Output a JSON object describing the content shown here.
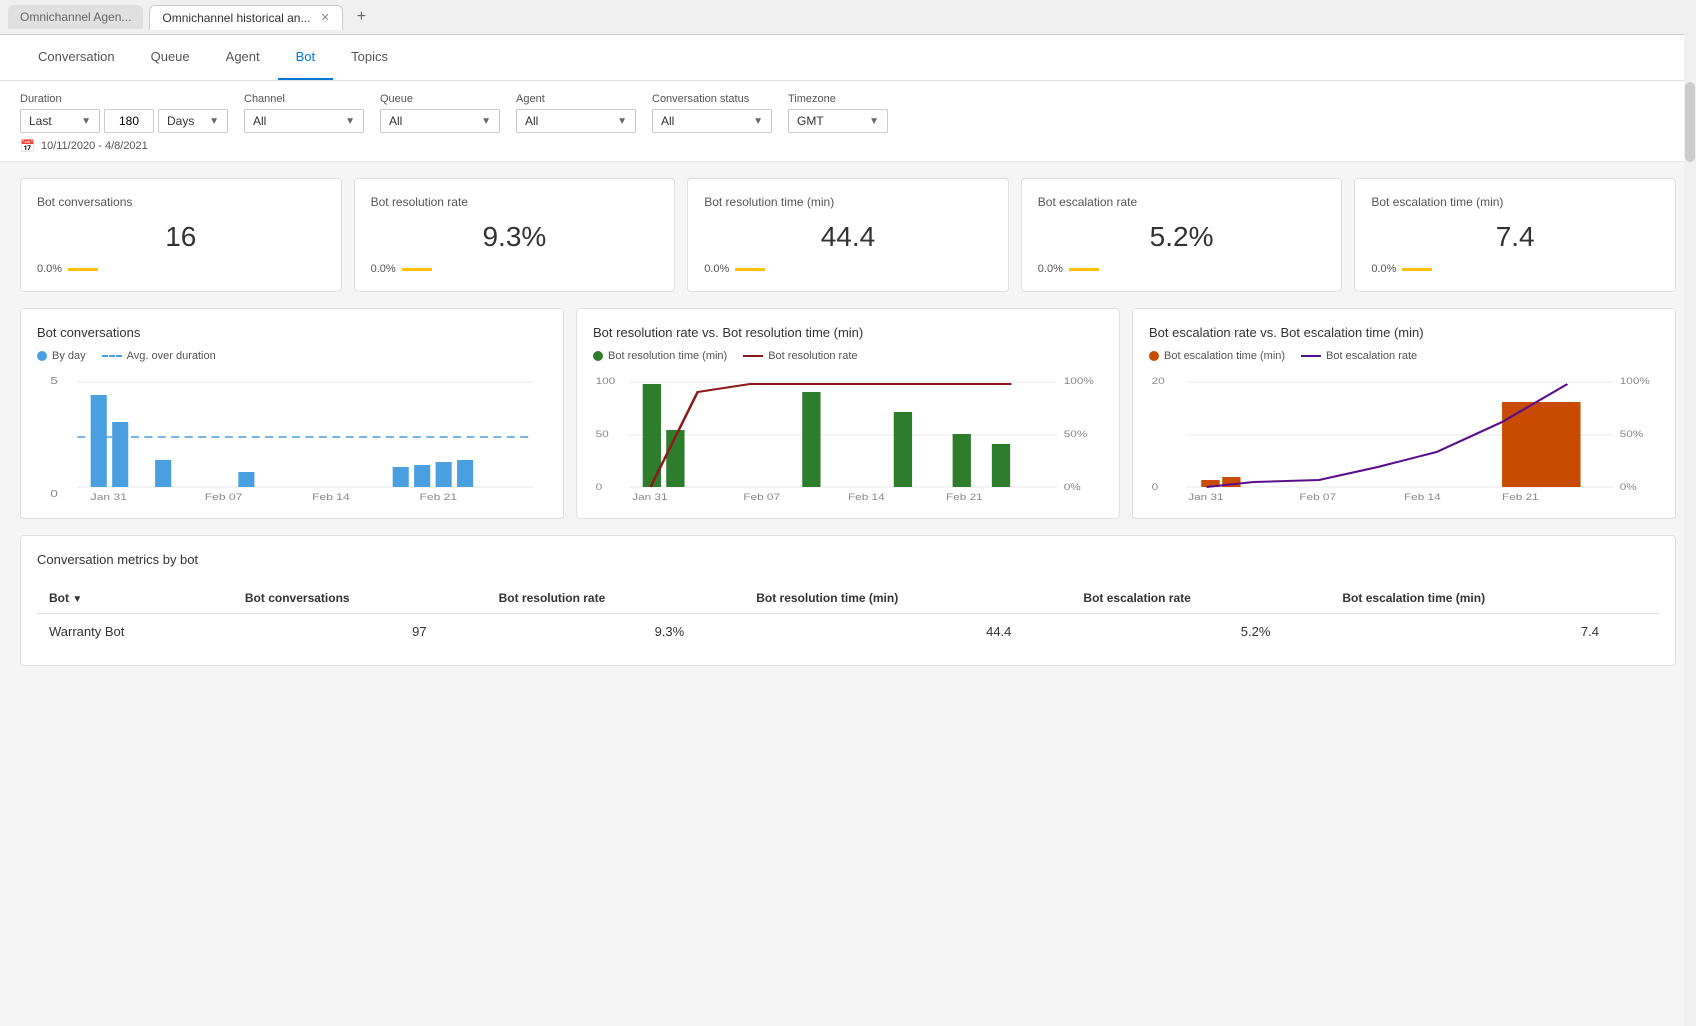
{
  "browser": {
    "tabs": [
      {
        "id": "tab1",
        "label": "Omnichannel Agen...",
        "active": false
      },
      {
        "id": "tab2",
        "label": "Omnichannel historical an...",
        "active": true
      }
    ],
    "add_tab_label": "+"
  },
  "nav": {
    "tabs": [
      {
        "id": "conversation",
        "label": "Conversation",
        "active": false
      },
      {
        "id": "queue",
        "label": "Queue",
        "active": false
      },
      {
        "id": "agent",
        "label": "Agent",
        "active": false
      },
      {
        "id": "bot",
        "label": "Bot",
        "active": true
      },
      {
        "id": "topics",
        "label": "Topics",
        "active": false
      }
    ]
  },
  "filters": {
    "duration_label": "Duration",
    "duration_preset": "Last",
    "duration_value": "180",
    "duration_unit": "Days",
    "channel_label": "Channel",
    "channel_value": "All",
    "queue_label": "Queue",
    "queue_value": "All",
    "agent_label": "Agent",
    "agent_value": "All",
    "conversation_status_label": "Conversation status",
    "conversation_status_value": "All",
    "timezone_label": "Timezone",
    "timezone_value": "GMT",
    "date_range": "10/11/2020 - 4/8/2021"
  },
  "kpis": [
    {
      "title": "Bot conversations",
      "value": "16",
      "change": "0.0%"
    },
    {
      "title": "Bot resolution rate",
      "value": "9.3%",
      "change": "0.0%"
    },
    {
      "title": "Bot resolution time (min)",
      "value": "44.4",
      "change": "0.0%"
    },
    {
      "title": "Bot escalation rate",
      "value": "5.2%",
      "change": "0.0%"
    },
    {
      "title": "Bot escalation time (min)",
      "value": "7.4",
      "change": "0.0%"
    }
  ],
  "charts": {
    "bot_conversations": {
      "title": "Bot conversations",
      "legend_by_day": "By day",
      "legend_avg": "Avg. over duration",
      "x_labels": [
        "Jan 31",
        "Feb 07",
        "Feb 14",
        "Feb 21"
      ],
      "y_max": 5,
      "y_labels": [
        "5",
        "0"
      ]
    },
    "resolution": {
      "title": "Bot resolution rate vs. Bot resolution time (min)",
      "legend_time": "Bot resolution time (min)",
      "legend_rate": "Bot resolution rate",
      "x_labels": [
        "Jan 31",
        "Feb 07",
        "Feb 14",
        "Feb 21"
      ],
      "y_left_max": 100,
      "y_right_labels": [
        "100%",
        "50%",
        "0%"
      ]
    },
    "escalation": {
      "title": "Bot escalation rate vs. Bot escalation time (min)",
      "legend_time": "Bot escalation time (min)",
      "legend_rate": "Bot escalation rate",
      "x_labels": [
        "Jan 31",
        "Feb 07",
        "Feb 14",
        "Feb 21"
      ],
      "y_right_labels": [
        "100%",
        "50%",
        "0%"
      ]
    }
  },
  "table": {
    "title": "Conversation metrics by bot",
    "headers": [
      "Bot",
      "Bot conversations",
      "Bot resolution rate",
      "Bot resolution time (min)",
      "Bot escalation rate",
      "Bot escalation time (min)"
    ],
    "rows": [
      {
        "bot": "Warranty Bot",
        "conversations": "97",
        "resolution_rate": "9.3%",
        "resolution_time": "44.4",
        "escalation_rate": "5.2%",
        "escalation_time": "7.4"
      }
    ]
  }
}
